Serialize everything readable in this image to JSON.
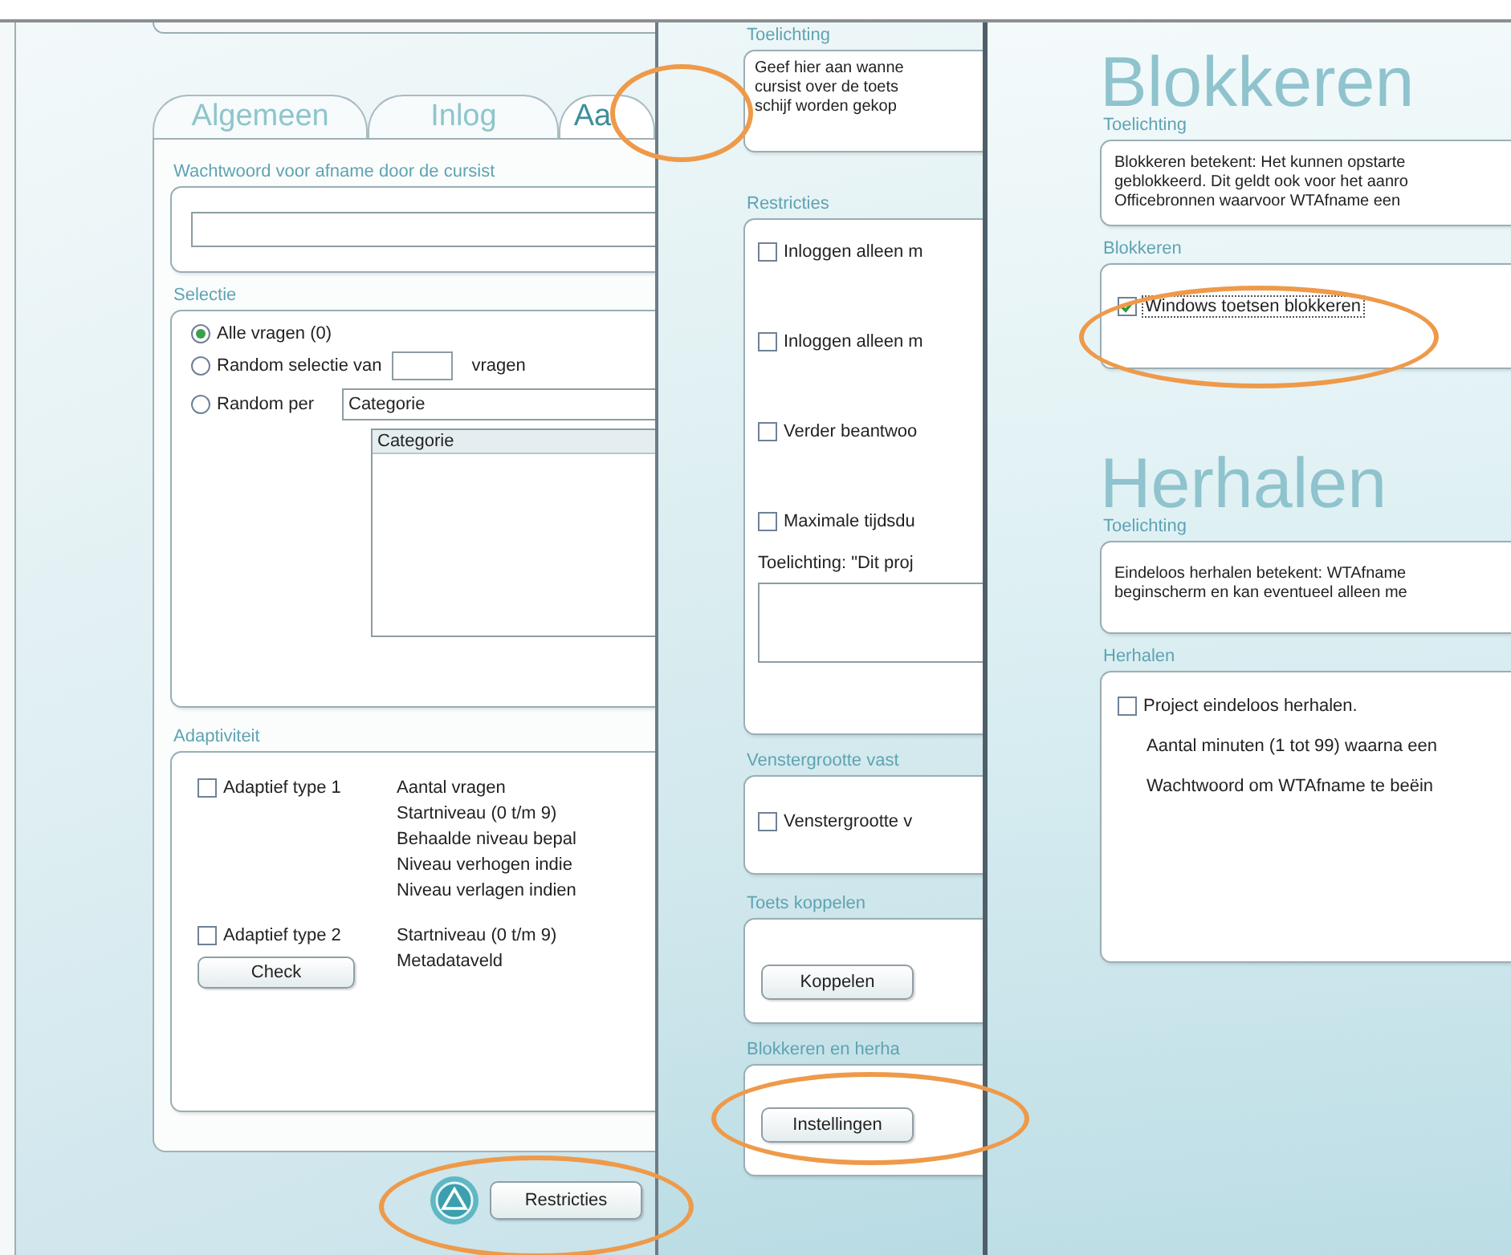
{
  "left_window": {
    "tabs": [
      {
        "label": "Algemeen",
        "selected": false
      },
      {
        "label": "Inlog",
        "selected": false
      },
      {
        "label": "Aa",
        "selected": true
      }
    ],
    "password_label": "Wachtwoord voor afname door de cursist",
    "selection": {
      "title": "Selectie",
      "options": [
        {
          "kind": "plain",
          "label": "Alle vragen (0)",
          "selected": true
        },
        {
          "kind": "count",
          "label": "Random selectie van",
          "suffix": "vragen",
          "selected": false
        },
        {
          "kind": "dropdown",
          "label": "Random per",
          "dropdown_value": "Categorie",
          "list_header": "Categorie",
          "selected": false
        }
      ]
    },
    "adaptivity": {
      "title": "Adaptiviteit",
      "types": [
        {
          "label": "Adaptief type 1",
          "checked": false,
          "settings": [
            "Aantal vragen",
            "Startniveau (0 t/m 9)",
            "Behaalde niveau bepal",
            "Niveau verhogen indie",
            "Niveau verlagen indien"
          ]
        },
        {
          "label": "Adaptief type 2",
          "checked": false,
          "settings": [
            "Startniveau (0 t/m 9)",
            "Metadataveld"
          ],
          "button": "Check"
        }
      ]
    },
    "restrictions_button": "Restricties"
  },
  "middle_window": {
    "explanation": {
      "title": "Toelichting",
      "lines": [
        "Geef hier aan wanne",
        "cursist over de toets",
        "schijf worden gekop"
      ]
    },
    "restrictions": {
      "title": "Restricties",
      "options": [
        {
          "label": "Inloggen alleen m",
          "checked": false
        },
        {
          "label": "Inloggen alleen m",
          "checked": false
        },
        {
          "label": "Verder beantwoo",
          "checked": false
        },
        {
          "label": "Maximale tijdsdu",
          "checked": false
        }
      ],
      "note_label": "Toelichting: \"Dit proj"
    },
    "window_size": {
      "title": "Venstergrootte vast",
      "option": {
        "label": "Venstergrootte v",
        "checked": false
      }
    },
    "link_test": {
      "title": "Toets koppelen",
      "button": "Koppelen"
    },
    "block_repeat": {
      "title": "Blokkeren en herha",
      "button": "Instellingen"
    }
  },
  "right_window": {
    "sections": [
      {
        "heading": "Blokkeren",
        "explanation_title": "Toelichting",
        "explanation_lines": [
          "Blokkeren betekent: Het kunnen opstarte",
          "geblokkeerd. Dit geldt ook voor het aanro",
          "Officebronnen waarvoor WTAfname een"
        ],
        "group_title": "Blokkeren",
        "option": {
          "label": "Windows toetsen blokkeren",
          "checked": true,
          "focused": true
        }
      },
      {
        "heading": "Herhalen",
        "explanation_title": "Toelichting",
        "explanation_lines": [
          "Eindeloos herhalen betekent: WTAfname",
          "beginscherm en kan eventueel alleen me"
        ],
        "group_title": "Herhalen",
        "option": {
          "label": "Project eindeloos herhalen.",
          "checked": false,
          "focused": false
        },
        "lines": [
          "Aantal minuten (1 tot 99) waarna een",
          "Wachtwoord om WTAfname te beëin"
        ]
      }
    ]
  }
}
